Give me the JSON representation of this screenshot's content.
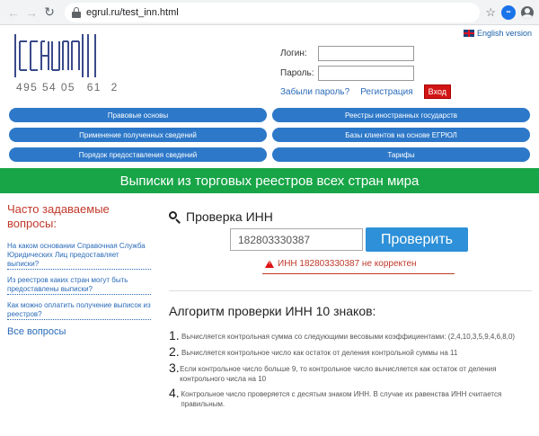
{
  "browser": {
    "url": "egrul.ru/test_inn.html"
  },
  "header": {
    "phone_parts": [
      "495 54 05",
      "61",
      "2"
    ],
    "lang_label": "English version",
    "login_label": "Логин:",
    "password_label": "Пароль:",
    "forgot_label": "Забыли пароль?",
    "register_label": "Регистрация",
    "enter_label": "Вход"
  },
  "nav": {
    "items": [
      "Правовые основы",
      "Реестры иностранных государств",
      "Применение полученных сведений",
      "Базы клиентов на основе ЕГРЮЛ",
      "Порядок предоставления сведений",
      "Тарифы"
    ]
  },
  "banner": {
    "text": "Выписки из торговых реестров всех стран мира"
  },
  "faq": {
    "title": "Часто задаваемые вопросы:",
    "items": [
      "На каком основании Справочная Служба Юридических Лиц предоставляет выписки?",
      "Из реестров каких стран могут быть предоставлены выписки?",
      "Как можно оплатить получение выписок из реестров?"
    ],
    "all_label": "Все вопросы"
  },
  "check": {
    "title": "Проверка ИНН",
    "input_value": "182803330387",
    "button_label": "Проверить",
    "error_text": "ИНН 182803330387 не корректен"
  },
  "algorithm": {
    "title": "Алгоритм проверки ИНН 10 знаков:",
    "steps": [
      {
        "num": "1.",
        "text": "Вычисляется контрольная сумма со следующими весовыми коэффициентами: (2,4,10,3,5,9,4,6,8,0)"
      },
      {
        "num": "2.",
        "text": "Вычисляется контрольное число как остаток от деления контрольной суммы на 11"
      },
      {
        "num": "3.",
        "text": "Если контрольное число больше 9, то контрольное число вычисляется как остаток от деления контрольного числа на 10"
      },
      {
        "num": "4.",
        "text": "Контрольное число проверяется с десятым знаком ИНН. В случае их равенства ИНН считается правильным."
      }
    ]
  }
}
